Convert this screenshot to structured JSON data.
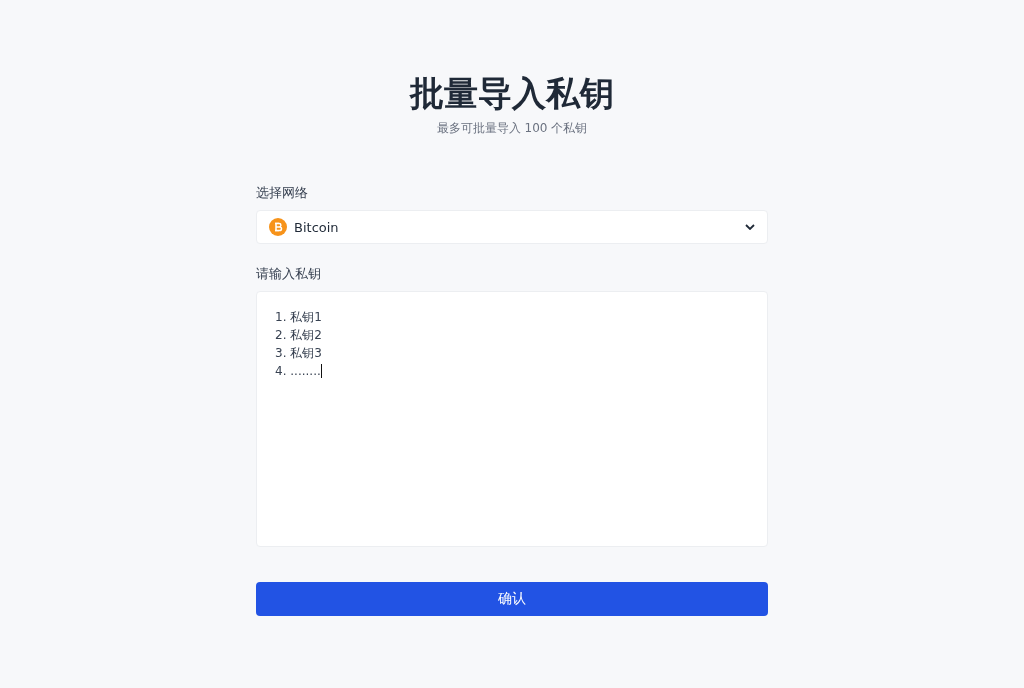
{
  "title": "批量导入私钥",
  "subtitle": "最多可批量导入 100 个私钥",
  "network": {
    "label": "选择网络",
    "value": "Bitcoin"
  },
  "keys": {
    "label": "请输入私钥",
    "lines": [
      "1. 私钥1",
      "2. 私钥2",
      "3. 私钥3",
      "4. ........"
    ]
  },
  "confirm_button": "确认"
}
